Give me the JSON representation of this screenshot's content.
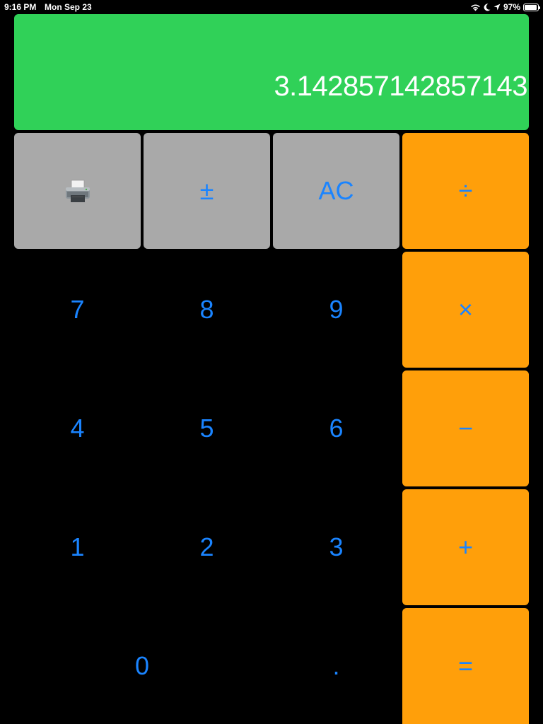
{
  "status_bar": {
    "time": "9:16 PM",
    "date": "Mon Sep 23",
    "battery_percent": "97%",
    "battery_level": 0.97,
    "icons": [
      "wifi-icon",
      "moon-icon",
      "location-arrow-icon",
      "battery-icon"
    ]
  },
  "display": {
    "value": "3.142857142857143"
  },
  "keys": {
    "print": {
      "icon": "printer-icon"
    },
    "plus_minus": "±",
    "all_clear": "AC",
    "divide": "÷",
    "multiply": "×",
    "subtract": "−",
    "add": "+",
    "equals": "=",
    "seven": "7",
    "eight": "8",
    "nine": "9",
    "four": "4",
    "five": "5",
    "six": "6",
    "one": "1",
    "two": "2",
    "three": "3",
    "zero": "0",
    "decimal": "."
  },
  "colors": {
    "display_bg": "#30d158",
    "function_key_bg": "#a9a9a9",
    "operator_key_bg": "#ff9f0a",
    "key_text": "#1a84ff",
    "app_bg": "#000000"
  }
}
